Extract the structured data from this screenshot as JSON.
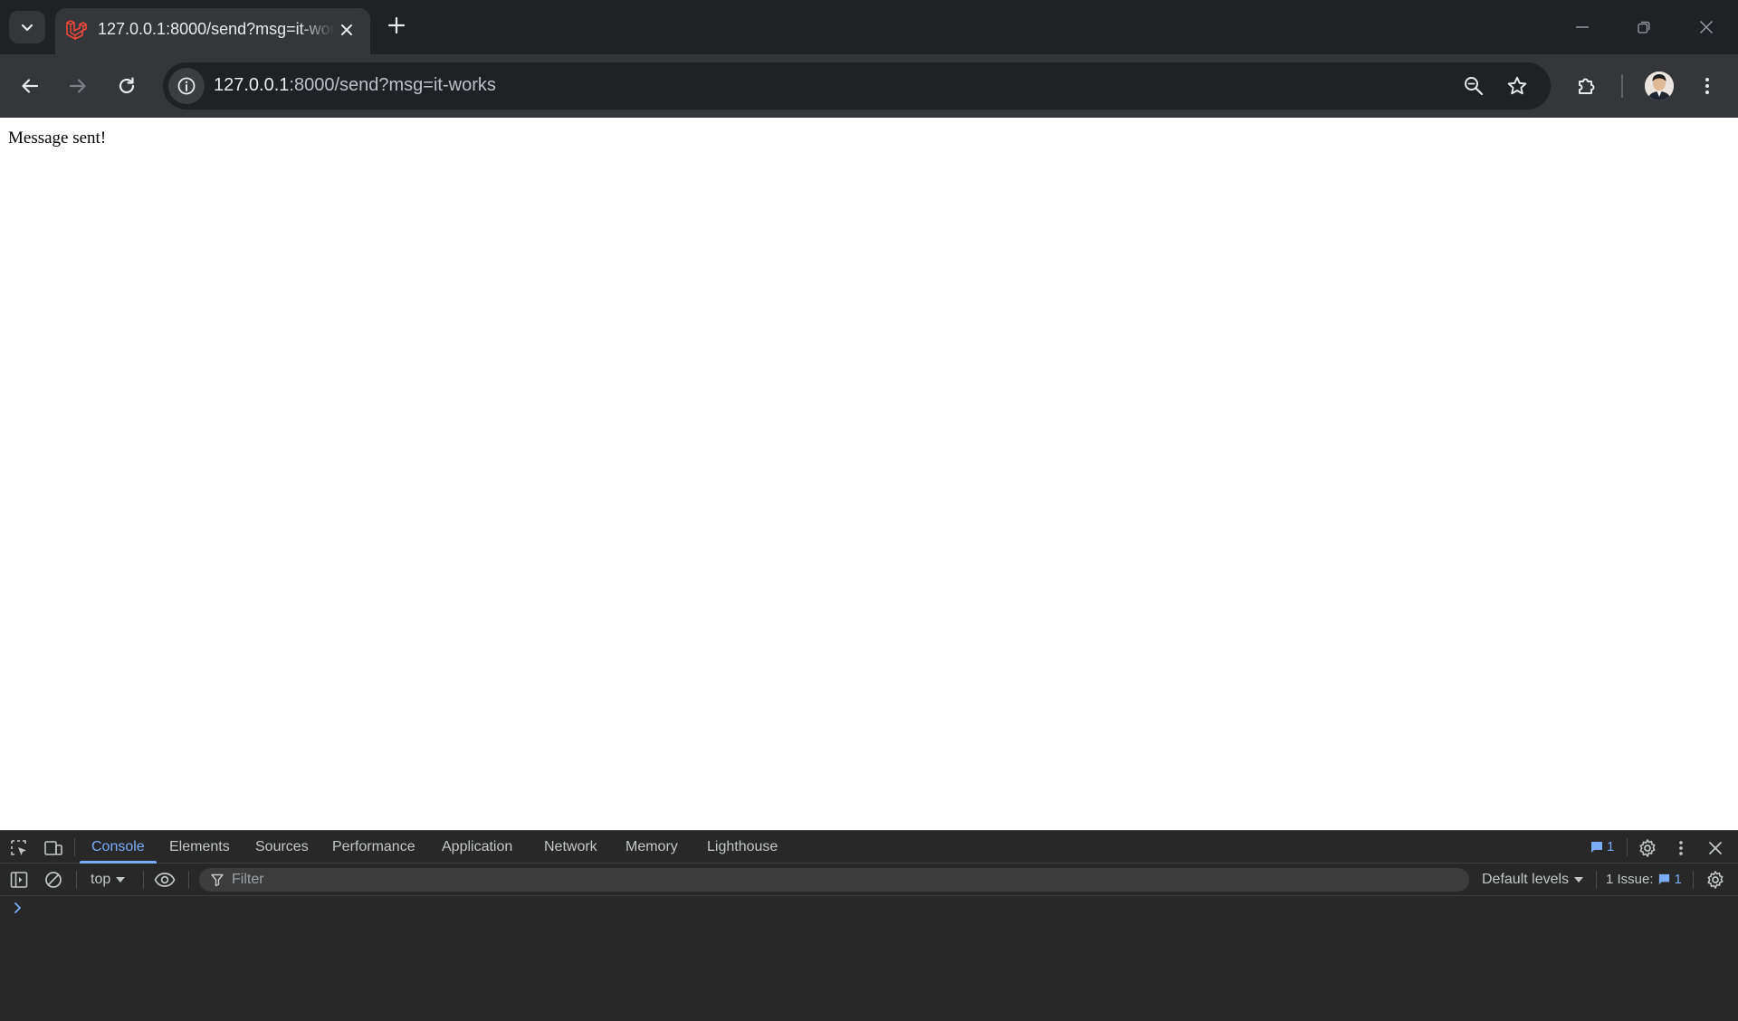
{
  "browser": {
    "tab": {
      "title": "127.0.0.1:8000/send?msg=it-works",
      "favicon": "laravel-icon"
    },
    "omnibox": {
      "url_host": "127.0.0.1",
      "url_rest": ":8000/send?msg=it-works"
    },
    "icons": {
      "tab_search": "chevron-down-icon",
      "new_tab": "plus-icon",
      "back": "arrow-left-icon",
      "forward": "arrow-right-icon",
      "reload": "reload-icon",
      "site_info": "info-icon",
      "zoom": "zoom-icon",
      "bookmark": "star-icon",
      "extensions": "puzzle-icon",
      "menu": "kebab-menu-icon"
    },
    "colors": {
      "frame": "#202124",
      "toolbar": "#35363a",
      "accent": "#7cacf8",
      "laravel": "#f0493a"
    }
  },
  "page": {
    "message": "Message sent!"
  },
  "devtools": {
    "tabs": [
      {
        "label": "Console",
        "active": true
      },
      {
        "label": "Elements",
        "active": false
      },
      {
        "label": "Sources",
        "active": false
      },
      {
        "label": "Performance",
        "active": false
      },
      {
        "label": "Application",
        "active": false
      },
      {
        "label": "Network",
        "active": false
      },
      {
        "label": "Memory",
        "active": false
      },
      {
        "label": "Lighthouse",
        "active": false
      }
    ],
    "issues_badge_count": "1",
    "console_toolbar": {
      "context": "top",
      "filter_placeholder": "Filter",
      "levels": "Default levels",
      "issues_label": "1 Issue:",
      "issues_count": "1"
    }
  }
}
